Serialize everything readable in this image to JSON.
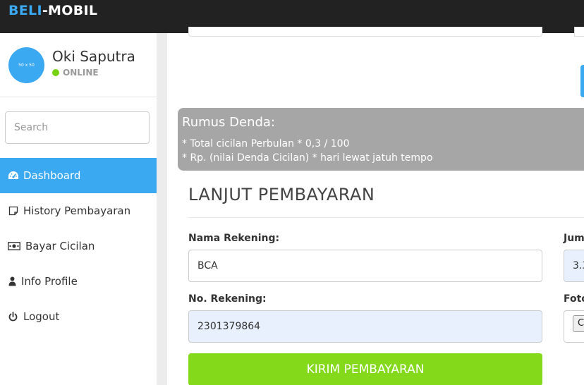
{
  "brand": {
    "accent": "BELI",
    "rest": "-MOBIL"
  },
  "user": {
    "avatar_text": "50 x 50",
    "name": "Oki Saputra",
    "status": "ONLINE"
  },
  "search": {
    "placeholder": "Search"
  },
  "nav": [
    {
      "label": "Dashboard",
      "icon": "dashboard-icon",
      "active": true
    },
    {
      "label": "History Pembayaran",
      "icon": "note-icon",
      "active": false
    },
    {
      "label": "Bayar Cicilan",
      "icon": "money-icon",
      "active": false
    },
    {
      "label": "Info Profile",
      "icon": "user-icon",
      "active": false
    },
    {
      "label": "Logout",
      "icon": "power-icon",
      "active": false
    }
  ],
  "formula": {
    "title": "Rumus Denda:",
    "lines": [
      "* Total cicilan Perbulan * 0,3 / 100",
      "* Rp. (nilai Denda Cicilan) * hari lewat jatuh tempo"
    ]
  },
  "form": {
    "title": "LANJUT PEMBAYARAN",
    "account_name_label": "Nama Rekening:",
    "account_name_value": "BCA",
    "account_number_label": "No. Rekening:",
    "account_number_value": "2301379864",
    "amount_label_partial": "Jum",
    "amount_value_partial": "3.3",
    "photo_label_partial": "Foto",
    "file_button_partial": "C",
    "submit_label": "KIRIM PEMBAYARAN"
  },
  "colors": {
    "topbar": "#222222",
    "brand_accent": "#3ba8f2",
    "active_nav": "#3ba8f2",
    "status_online": "#77d311",
    "formula_box": "#a6a6a6",
    "submit": "#84d91a",
    "autofill": "#e8f0fe"
  }
}
